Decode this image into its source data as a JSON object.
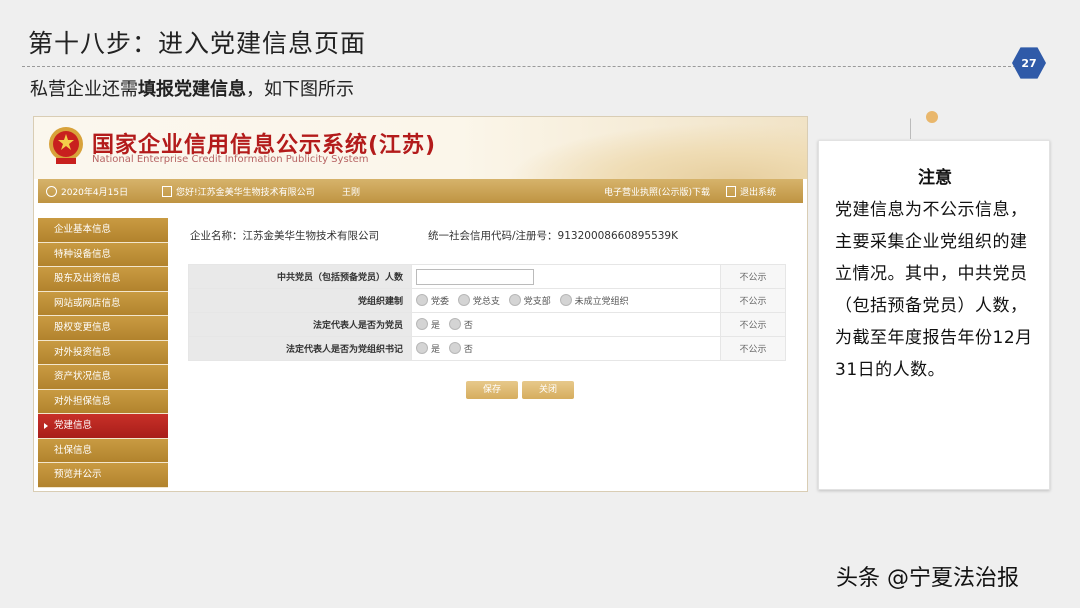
{
  "slide": {
    "title": "第十八步：进入党建信息页面",
    "page_number": "27",
    "subtitle_pre": "私营企业还需",
    "subtitle_bold": "填报党建信息",
    "subtitle_post": "，如下图所示"
  },
  "portal": {
    "title_cn": "国家企业信用信息公示系统(江苏)",
    "title_en": "National Enterprise Credit Information Publicity System",
    "infobar": {
      "date": "2020年4月15日",
      "welcome": "您好!江苏金美华生物技术有限公司",
      "user": "王刚",
      "license_download": "电子营业执照(公示版)下载",
      "logout": "退出系统"
    },
    "sidebar": [
      {
        "label": "企业基本信息",
        "active": false
      },
      {
        "label": "特种设备信息",
        "active": false
      },
      {
        "label": "股东及出资信息",
        "active": false
      },
      {
        "label": "网站或网店信息",
        "active": false
      },
      {
        "label": "股权变更信息",
        "active": false
      },
      {
        "label": "对外投资信息",
        "active": false
      },
      {
        "label": "资产状况信息",
        "active": false
      },
      {
        "label": "对外担保信息",
        "active": false
      },
      {
        "label": "党建信息",
        "active": true
      },
      {
        "label": "社保信息",
        "active": false
      },
      {
        "label": "预览并公示",
        "active": false
      }
    ],
    "company_label": "企业名称：江苏金美华生物技术有限公司",
    "credit_label": "统一社会信用代码/注册号：91320008660895539K",
    "form": {
      "row1_label": "中共党员（包括预备党员）人数",
      "row1_value": "",
      "row1_visibility": "不公示",
      "row2_label": "党组织建制",
      "row2_options": [
        "党委",
        "党总支",
        "党支部",
        "未成立党组织"
      ],
      "row2_visibility": "不公示",
      "row3_label": "法定代表人是否为党员",
      "row3_options": [
        "是",
        "否"
      ],
      "row3_visibility": "不公示",
      "row4_label": "法定代表人是否为党组织书记",
      "row4_options": [
        "是",
        "否"
      ],
      "row4_visibility": "不公示"
    },
    "buttons": {
      "save": "保存",
      "close": "关闭"
    }
  },
  "note": {
    "title": "注意",
    "body": "党建信息为不公示信息，主要采集企业党组织的建立情况。其中，中共党员（包括预备党员）人数，为截至年度报告年份12月31日的人数。"
  },
  "watermark": "头条 @宁夏法治报",
  "colors": {
    "accent_gold": "#c99b42",
    "active_red": "#c83028",
    "portal_title_red": "#b31b1b",
    "page_badge": "#2f5aa8"
  }
}
